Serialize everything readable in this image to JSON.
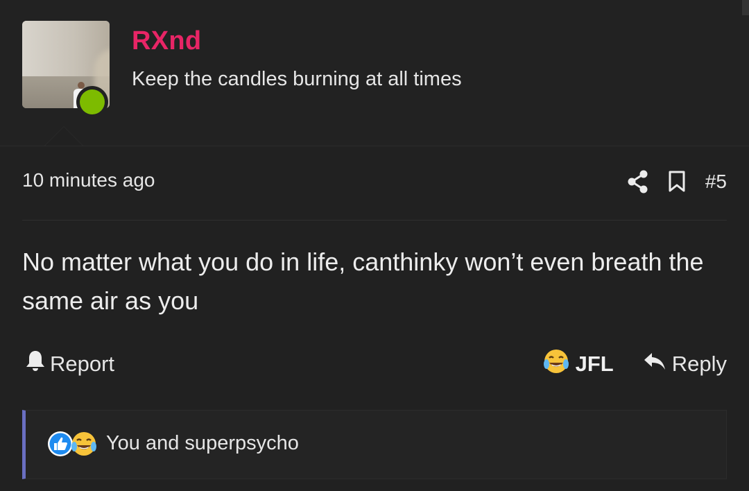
{
  "user": {
    "name": "RXnd",
    "title": "Keep the candles burning at all times",
    "online": true,
    "name_color": "#e82566",
    "status_color": "#7dbb00"
  },
  "post": {
    "time": "10 minutes ago",
    "number": "#5",
    "body": "No matter what you do in life, canthinky won’t even breath the same air as you"
  },
  "actions": {
    "report_label": "Report",
    "reaction_label": "JFL",
    "reply_label": "Reply"
  },
  "reactions": {
    "summary": "You and superpsycho",
    "icons": [
      "like-icon",
      "joy-tears-emoji-icon"
    ],
    "bar_accent": "#6a6fc2"
  },
  "icons": {
    "share": "share-icon",
    "bookmark": "bookmark-icon",
    "bell": "bell-icon",
    "reply": "reply-arrow-icon"
  }
}
